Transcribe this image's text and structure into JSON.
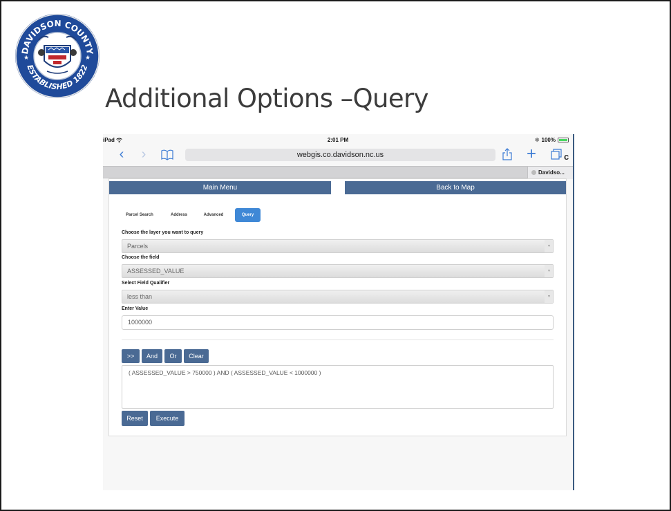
{
  "slide": {
    "title": "Additional Options –Query",
    "seal": {
      "top_text": "DAVIDSON COUNTY",
      "bottom_text": "ESTABLISHED 1822",
      "colors": {
        "ring": "#1f4a9a",
        "field": "#ffffff",
        "accent": "#c0282d"
      }
    }
  },
  "device": {
    "status": {
      "carrier": "iPad",
      "time": "2:01 PM",
      "battery": "100%"
    },
    "browser": {
      "url": "webgis.co.davidson.nc.us",
      "tab_title": "Davidso...",
      "icons": [
        "back-icon",
        "forward-icon",
        "bookmarks-icon",
        "reload-icon",
        "share-icon",
        "new-tab-icon",
        "tabs-icon"
      ]
    }
  },
  "app": {
    "main_menu": "Main Menu",
    "back_to_map": "Back to Map",
    "tabs": [
      {
        "label": "Parcel Search",
        "active": false
      },
      {
        "label": "Address",
        "active": false
      },
      {
        "label": "Advanced",
        "active": false
      },
      {
        "label": "Query",
        "active": true
      }
    ],
    "layer_label": "Choose the layer you want to query",
    "layer_value": "Parcels",
    "field_label": "Choose the field",
    "field_value": "ASSESSED_VALUE",
    "qualifier_label": "Select Field Qualifier",
    "qualifier_value": "less than",
    "value_label": "Enter Value",
    "value_value": "1000000",
    "ops": {
      "add": ">>",
      "and": "And",
      "or": "Or",
      "clear": "Clear"
    },
    "query_text": "( ASSESSED_VALUE > 750000 ) AND ( ASSESSED_VALUE < 1000000 )",
    "reset": "Reset",
    "execute": "Execute",
    "colors": {
      "button": "#4a6a94",
      "active_tab": "#3f88d6",
      "link": "#3b7bd4"
    }
  }
}
